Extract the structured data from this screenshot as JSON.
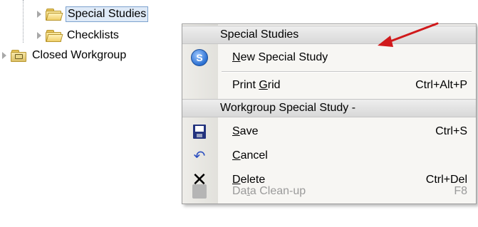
{
  "tree": {
    "items": [
      {
        "label": "Special Studies",
        "selected": true,
        "icon": "folder-icon"
      },
      {
        "label": "Checklists",
        "selected": false,
        "icon": "folder-icon"
      },
      {
        "label": "Closed Workgroup",
        "selected": false,
        "icon": "locked-folder-icon"
      }
    ]
  },
  "menu": {
    "header1": "Special Studies",
    "new_special_study": {
      "label": "New Special Study",
      "mnemonic_index": 0,
      "icon": "special-study-icon"
    },
    "print_grid": {
      "label": "Print Grid",
      "shortcut": "Ctrl+Alt+P"
    },
    "header2": "Workgroup Special Study -",
    "save": {
      "label": "Save",
      "shortcut": "Ctrl+S",
      "icon": "save-icon"
    },
    "cancel": {
      "label": "Cancel",
      "shortcut": "",
      "icon": "undo-icon"
    },
    "delete": {
      "label": "Delete",
      "shortcut": "Ctrl+Del",
      "icon": "delete-icon"
    },
    "data_cleanup": {
      "label": "Data Clean-up",
      "shortcut": "F8",
      "disabled": true,
      "icon": "disabled-icon"
    }
  },
  "colors": {
    "callout_arrow": "#d0191b",
    "selection_border": "#7da2ce",
    "selection_bg": "#dfeaf7"
  }
}
